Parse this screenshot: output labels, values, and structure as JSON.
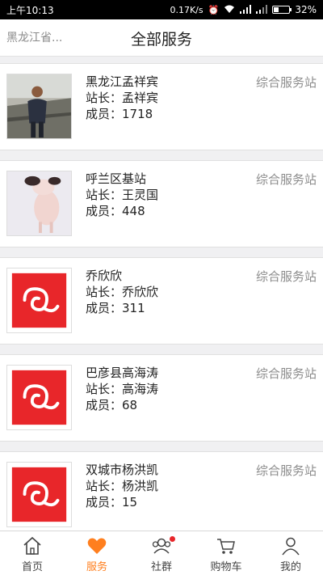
{
  "status_bar": {
    "time": "上午10:13",
    "network_speed": "0.17K/s",
    "battery_percent": "32%",
    "battery_level": 0.32
  },
  "header": {
    "location": "黑龙江省...",
    "title": "全部服务"
  },
  "stations": [
    {
      "name": "黑龙江孟祥宾",
      "manager_label": "站长：",
      "manager": "孟祥宾",
      "members_label": "成员：",
      "members": "1718",
      "type": "综合服务站",
      "thumbnail": "person-photo"
    },
    {
      "name": "呼兰区基站",
      "manager_label": "站长：",
      "manager": "王灵国",
      "members_label": "成员：",
      "members": "448",
      "type": "综合服务站",
      "thumbnail": "pig-photo"
    },
    {
      "name": "乔欣欣",
      "manager_label": "站长：",
      "manager": "乔欣欣",
      "members_label": "成员：",
      "members": "311",
      "type": "综合服务站",
      "thumbnail": "red-logo"
    },
    {
      "name": "巴彦县高海涛",
      "manager_label": "站长：",
      "manager": "高海涛",
      "members_label": "成员：",
      "members": "68",
      "type": "综合服务站",
      "thumbnail": "red-logo"
    },
    {
      "name": "双城市杨洪凯",
      "manager_label": "站长：",
      "manager": "杨洪凯",
      "members_label": "成员：",
      "members": "15",
      "type": "综合服务站",
      "thumbnail": "red-logo"
    }
  ],
  "tabbar": {
    "items": [
      {
        "label": "首页",
        "icon": "home-icon",
        "active": false
      },
      {
        "label": "服务",
        "icon": "heart-icon",
        "active": true
      },
      {
        "label": "社群",
        "icon": "community-icon",
        "active": false,
        "badge": true
      },
      {
        "label": "购物车",
        "icon": "cart-icon",
        "active": false
      },
      {
        "label": "我的",
        "icon": "profile-icon",
        "active": false
      }
    ]
  },
  "colors": {
    "accent": "#ff7f1e",
    "logo_red": "#e8262a",
    "badge": "#e8262a"
  }
}
